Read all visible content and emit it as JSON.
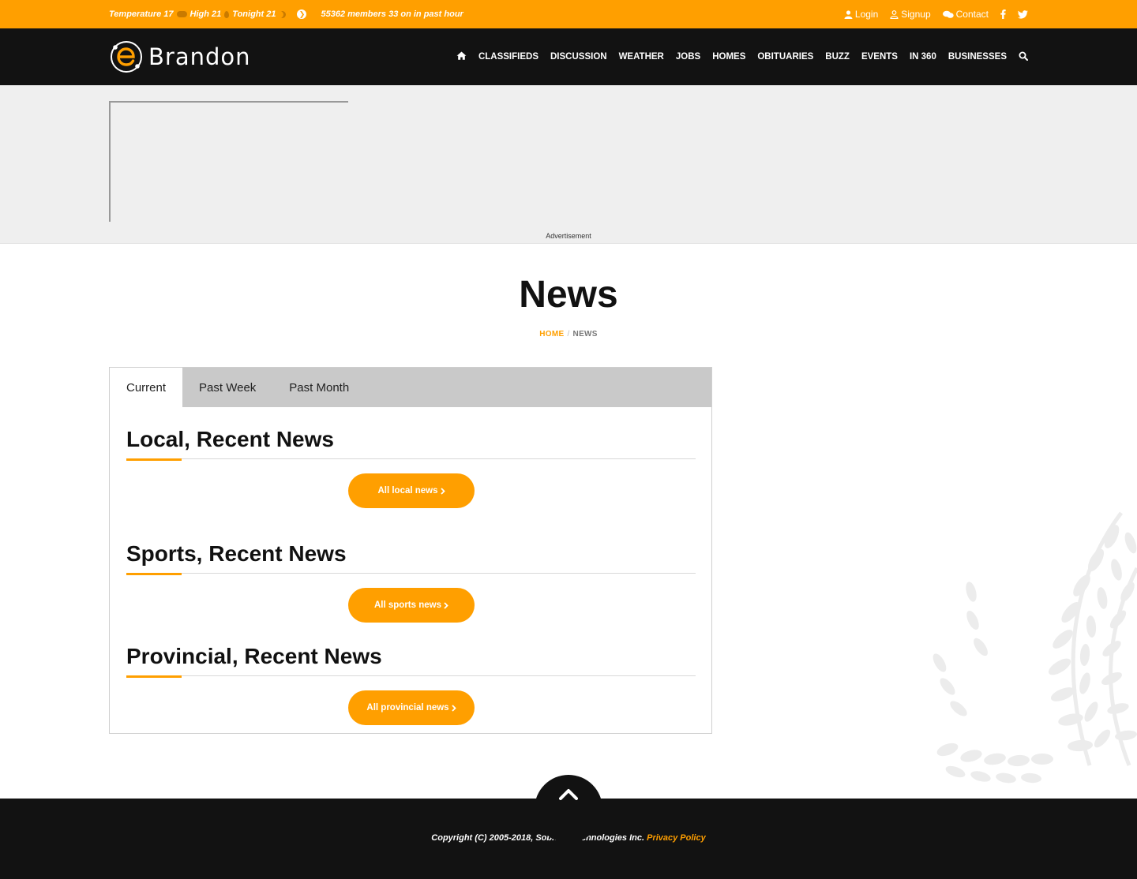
{
  "topbar": {
    "temperature": "Temperature 17",
    "high": "High 21",
    "tonight": "Tonight 21",
    "members": "55362 members 33 on in past hour",
    "login": "Login",
    "signup": "Signup",
    "contact": "Contact"
  },
  "logo": {
    "text": "Brandon"
  },
  "nav": {
    "items": [
      "CLASSIFIEDS",
      "DISCUSSION",
      "WEATHER",
      "JOBS",
      "HOMES",
      "OBITUARIES",
      "BUZZ",
      "EVENTS",
      "IN 360",
      "BUSINESSES"
    ]
  },
  "ad": {
    "label": "Advertisement"
  },
  "page": {
    "title": "News",
    "breadcrumb_home": "HOME",
    "breadcrumb_sep": "/",
    "breadcrumb_current": "NEWS"
  },
  "tabs": [
    "Current",
    "Past Week",
    "Past Month"
  ],
  "sections": [
    {
      "title": "Local, Recent News",
      "button": "All local news"
    },
    {
      "title": "Sports, Recent News",
      "button": "All sports news"
    },
    {
      "title": "Provincial, Recent News",
      "button": "All provincial news"
    }
  ],
  "footer": {
    "copyright": "Copyright (C) 2005-2018, Sobkow Technologies Inc.",
    "privacy": "Privacy Policy"
  },
  "colors": {
    "accent": "#ff9f00",
    "dark": "#121212",
    "ad_bg": "#efefef",
    "tab_bg": "#c9c9c9"
  }
}
